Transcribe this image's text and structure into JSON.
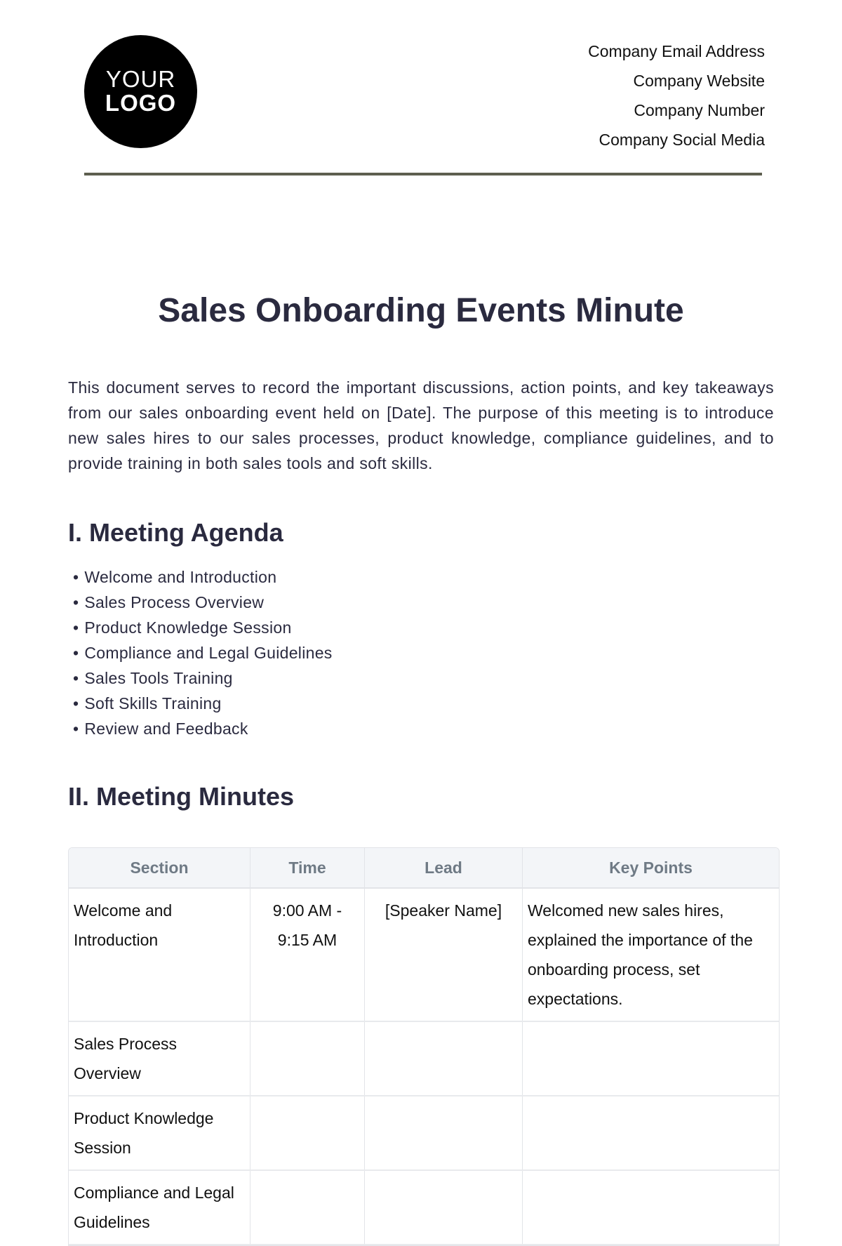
{
  "header": {
    "logo": {
      "line1": "YOUR",
      "line2": "LOGO"
    },
    "contact": [
      "Company Email Address",
      "Company Website",
      "Company Number",
      "Company Social Media"
    ]
  },
  "document": {
    "title": "Sales Onboarding Events Minute",
    "intro": "This document serves to record the important discussions, action points, and key takeaways from our sales onboarding event held on [Date]. The purpose of this meeting is to introduce new sales hires to our sales processes, product knowledge, compliance guidelines, and to provide training in both sales tools and soft skills.",
    "sections": [
      {
        "heading": "I. Meeting Agenda",
        "items": [
          "Welcome and Introduction",
          "Sales Process Overview",
          "Product Knowledge Session",
          "Compliance and Legal Guidelines",
          "Sales Tools Training",
          "Soft Skills Training",
          "Review and Feedback"
        ]
      },
      {
        "heading": "II. Meeting Minutes"
      }
    ],
    "table": {
      "headers": [
        "Section",
        "Time",
        "Lead",
        "Key Points"
      ],
      "rows": [
        [
          "Welcome and Introduction",
          "9:00 AM - 9:15 AM",
          "[Speaker Name]",
          "Welcomed new sales hires, explained the importance of the onboarding process, set expectations."
        ],
        [
          "Sales Process Overview",
          "",
          "",
          ""
        ],
        [
          "Product Knowledge Session",
          "",
          "",
          ""
        ],
        [
          "Compliance and Legal Guidelines",
          "",
          "",
          ""
        ]
      ]
    }
  }
}
